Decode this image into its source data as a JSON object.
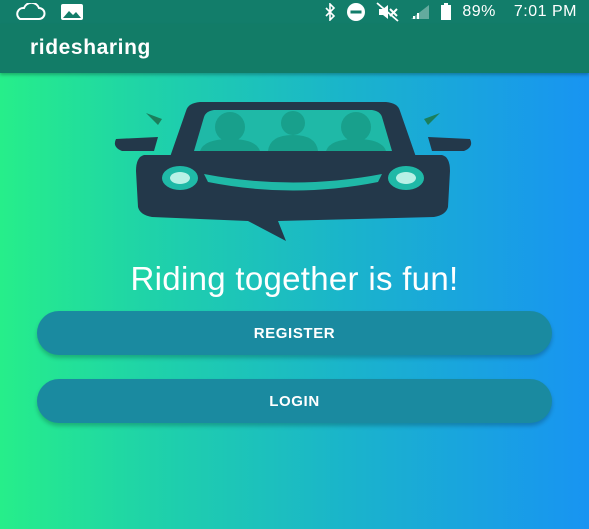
{
  "status_bar": {
    "battery": "89%",
    "time": "7:01 PM",
    "icons": [
      "cloud-icon",
      "image-icon",
      "bluetooth-icon",
      "do-not-disturb-icon",
      "vibrate-off-icon",
      "signal-icon",
      "battery-icon"
    ]
  },
  "app_bar": {
    "title": "ridesharing"
  },
  "main": {
    "tagline": "Riding together is fun!",
    "register_label": "REGISTER",
    "login_label": "LOGIN"
  },
  "colors": {
    "toolbar": "#127c67",
    "gradient_start": "#26ee8a",
    "gradient_end": "#1894f2",
    "button": "#1a8aa0",
    "car_body": "#23384a"
  }
}
